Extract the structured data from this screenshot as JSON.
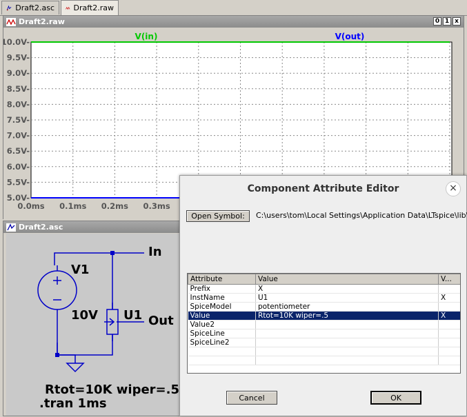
{
  "tabs": [
    {
      "label": "Draft2.asc",
      "icon": "schematic-icon"
    },
    {
      "label": "Draft2.raw",
      "icon": "waveform-icon"
    }
  ],
  "plot_window": {
    "title": "Draft2.raw",
    "btn_restore": "0",
    "btn_max": "1",
    "btn_close": "x"
  },
  "chart_data": {
    "type": "line",
    "series": [
      {
        "name": "V(in)",
        "color": "#00c800",
        "x": [
          0,
          1.0
        ],
        "y": [
          10.0,
          10.0
        ]
      },
      {
        "name": "V(out)",
        "color": "#0000ff",
        "x": [
          0,
          1.0
        ],
        "y": [
          5.0,
          5.0
        ]
      }
    ],
    "xlim": [
      0,
      1.0
    ],
    "ylim": [
      5.0,
      10.0
    ],
    "yticks": [
      "10.0V-",
      "9.5V-",
      "9.0V-",
      "8.5V-",
      "8.0V-",
      "7.5V-",
      "7.0V-",
      "6.5V-",
      "6.0V-",
      "5.5V-",
      "5.0V-"
    ],
    "xticks": [
      "0.0ms",
      "0.1ms",
      "0.2ms",
      "0.3ms"
    ],
    "grid": true
  },
  "schematic_window": {
    "title": "Draft2.asc",
    "v1_name": "V1",
    "v1_value": "10V",
    "u1_name": "U1",
    "label_in": "In",
    "label_out": "Out",
    "directive1": "Rtot=10K wiper=.5",
    "directive2": ".tran 1ms"
  },
  "dialog": {
    "title": "Component Attribute Editor",
    "open_symbol_label": "Open Symbol:",
    "symbol_path": "C:\\users\\tom\\Local Settings\\Application Data\\LTspice\\lib\\sym\\",
    "columns": [
      "Attribute",
      "Value",
      "V..."
    ],
    "rows": [
      {
        "attr": "Prefix",
        "value": "X",
        "vis": ""
      },
      {
        "attr": "InstName",
        "value": "U1",
        "vis": "X"
      },
      {
        "attr": "SpiceModel",
        "value": "potentiometer",
        "vis": ""
      },
      {
        "attr": "Value",
        "value": "Rtot=10K wiper=.5",
        "vis": "X",
        "selected": true
      },
      {
        "attr": "Value2",
        "value": "",
        "vis": ""
      },
      {
        "attr": "SpiceLine",
        "value": "",
        "vis": ""
      },
      {
        "attr": "SpiceLine2",
        "value": "",
        "vis": ""
      }
    ],
    "cancel_label": "Cancel",
    "ok_label": "OK",
    "close_glyph": "×"
  }
}
